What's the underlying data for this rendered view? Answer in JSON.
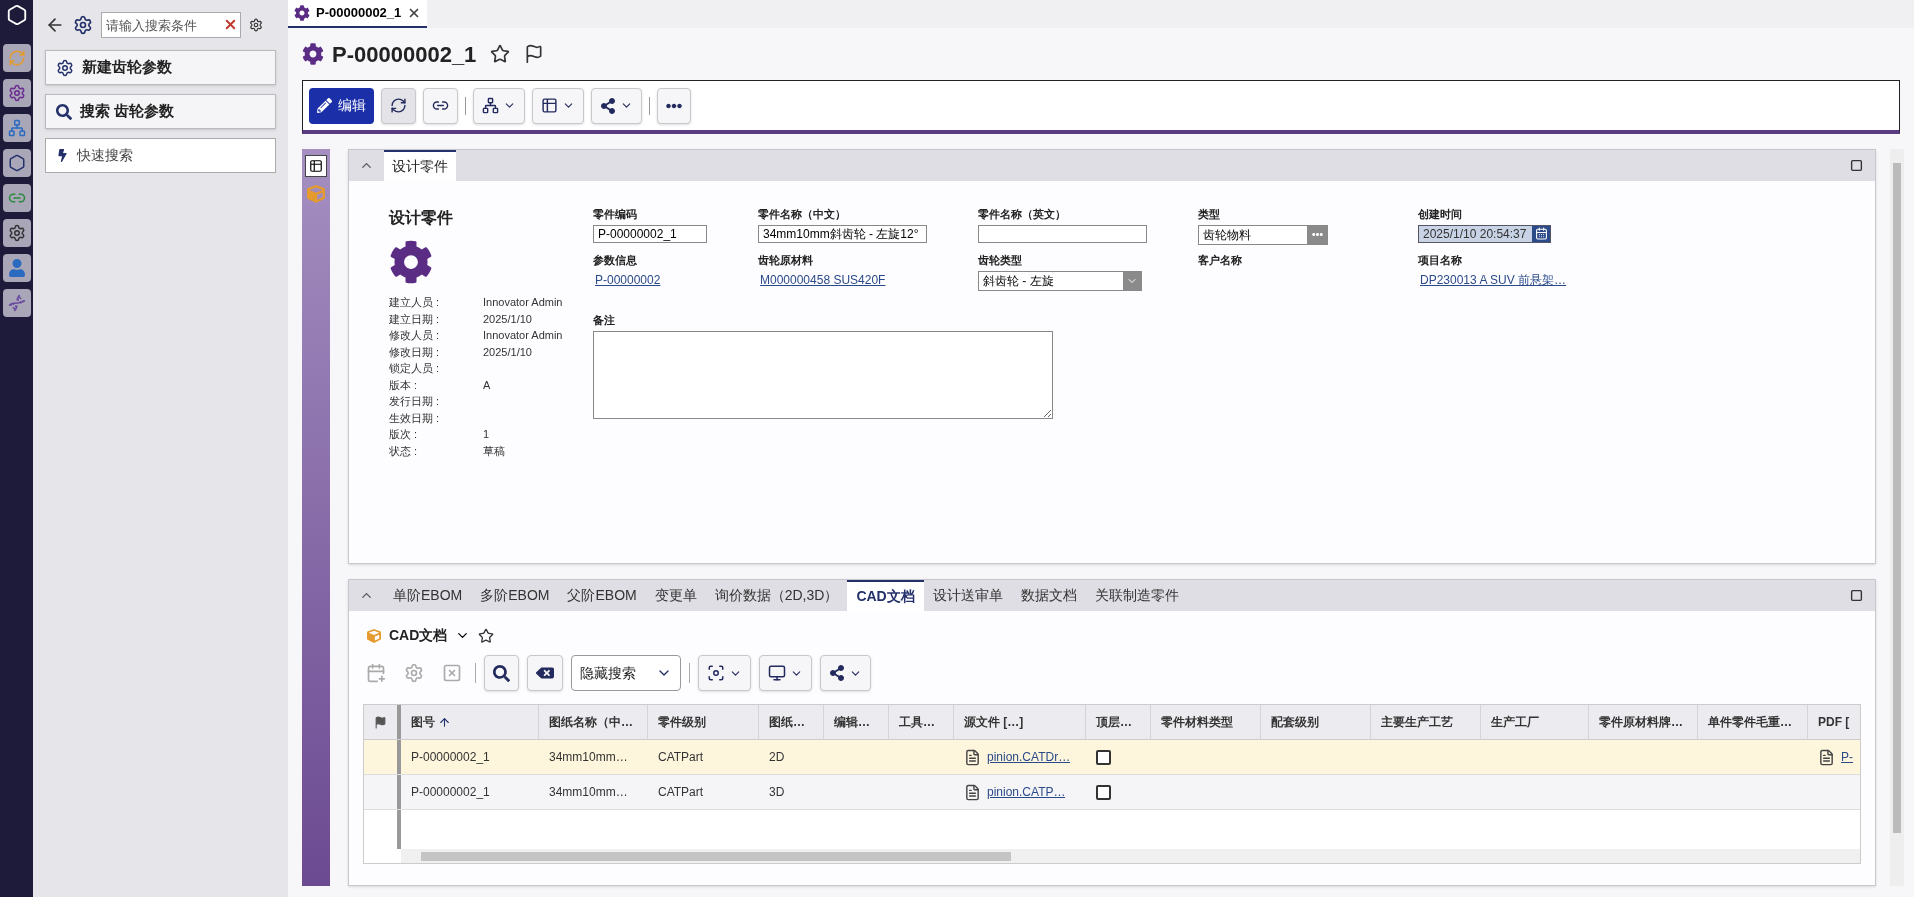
{
  "doc_tab": {
    "title": "P-00000002_1",
    "selected": true
  },
  "sidebar": {
    "search": {
      "placeholder": "请输入搜索条件"
    },
    "actions": [
      {
        "kind": "new",
        "label": "新建齿轮参数"
      },
      {
        "kind": "search",
        "label": "搜索 齿轮参数"
      },
      {
        "kind": "quick",
        "label": "快速搜索"
      }
    ]
  },
  "item": {
    "title": "P-00000002_1"
  },
  "toolbar": {
    "edit_label": "编辑"
  },
  "form": {
    "section_tab": "设计零件",
    "heading": "设计零件",
    "meta": [
      {
        "label": "建立人员 :",
        "value": "Innovator Admin"
      },
      {
        "label": "建立日期 :",
        "value": "2025/1/10"
      },
      {
        "label": "修改人员 :",
        "value": "Innovator Admin"
      },
      {
        "label": "修改日期 :",
        "value": "2025/1/10"
      },
      {
        "label": "锁定人员 :"
      },
      {
        "label": "版本 :",
        "value": "A"
      },
      {
        "label": "发行日期 :"
      },
      {
        "label": "生效日期 :"
      },
      {
        "label": "版次 :",
        "value": "1"
      },
      {
        "label": "状态 :",
        "value": "草稿"
      }
    ],
    "fields": [
      {
        "kind": "text",
        "label": "零件编码",
        "value": "P-00000002_1"
      },
      {
        "kind": "text",
        "label": "零件名称（中文）",
        "value": "34mm10mm斜齿轮 - 左旋12°"
      },
      {
        "kind": "text",
        "label": "零件名称（英文）"
      },
      {
        "kind": "lookup",
        "label": "类型",
        "value": "齿轮物料"
      },
      {
        "kind": "date",
        "label": "创建时间",
        "value": "2025/1/10 20:54:37"
      },
      {
        "kind": "link",
        "label": "参数信息",
        "value": "P-00000002"
      },
      {
        "kind": "link",
        "label": "齿轮原材料",
        "value": "M000000458 SUS420F"
      },
      {
        "kind": "select",
        "label": "齿轮类型",
        "value": "斜齿轮 - 左旋"
      },
      {
        "kind": "link",
        "label": "客户名称"
      },
      {
        "kind": "link",
        "label": "项目名称",
        "value": "DP230013 A SUV 前悬架…"
      }
    ],
    "remarks": {
      "label": "备注"
    }
  },
  "relations": {
    "tabs": [
      {
        "label": "单阶EBOM",
        "selected": false
      },
      {
        "label": "多阶EBOM",
        "selected": false
      },
      {
        "label": "父阶EBOM",
        "selected": false
      },
      {
        "label": "变更单",
        "selected": false
      },
      {
        "label": "询价数据（2D,3D）",
        "selected": false
      },
      {
        "label": "CAD文档",
        "selected": true
      },
      {
        "label": "设计送审单",
        "selected": false
      },
      {
        "label": "数据文档",
        "selected": false
      },
      {
        "label": "关联制造零件",
        "selected": false
      }
    ],
    "panel_title": "CAD文档",
    "search_mode": "隐藏搜索",
    "table": {
      "columns": [
        {
          "label": "图号",
          "kind": "text",
          "sorted": true
        },
        {
          "label": "图纸名称（中…",
          "kind": "text"
        },
        {
          "label": "零件级别",
          "kind": "text"
        },
        {
          "label": "图纸…",
          "kind": "text"
        },
        {
          "label": "编辑…",
          "kind": "text"
        },
        {
          "label": "工具…",
          "kind": "text"
        },
        {
          "label": "源文件 […]",
          "kind": "file"
        },
        {
          "label": "顶层…",
          "kind": "checkbox"
        },
        {
          "label": "零件材料类型",
          "kind": "text"
        },
        {
          "label": "配套级别",
          "kind": "text"
        },
        {
          "label": "主要生产工艺",
          "kind": "text"
        },
        {
          "label": "生产工厂",
          "kind": "text"
        },
        {
          "label": "零件原材料牌…",
          "kind": "text"
        },
        {
          "label": "单件零件毛重…",
          "kind": "text"
        },
        {
          "label": "PDF [",
          "kind": "file"
        }
      ],
      "rows": [
        {
          "selected": true,
          "cells": [
            "P-00000002_1",
            "34mm10mm…",
            "CATPart",
            "2D",
            null,
            null,
            "pinion.CATDr…",
            {
              "checked": false
            },
            null,
            null,
            null,
            null,
            null,
            null,
            "P-"
          ]
        },
        {
          "selected": false,
          "cells": [
            "P-00000002_1",
            "34mm10mm…",
            "CATPart",
            "3D",
            null,
            null,
            "pinion.CATP…",
            {
              "checked": false
            },
            null,
            null,
            null,
            null,
            null,
            null,
            null
          ]
        }
      ]
    }
  }
}
